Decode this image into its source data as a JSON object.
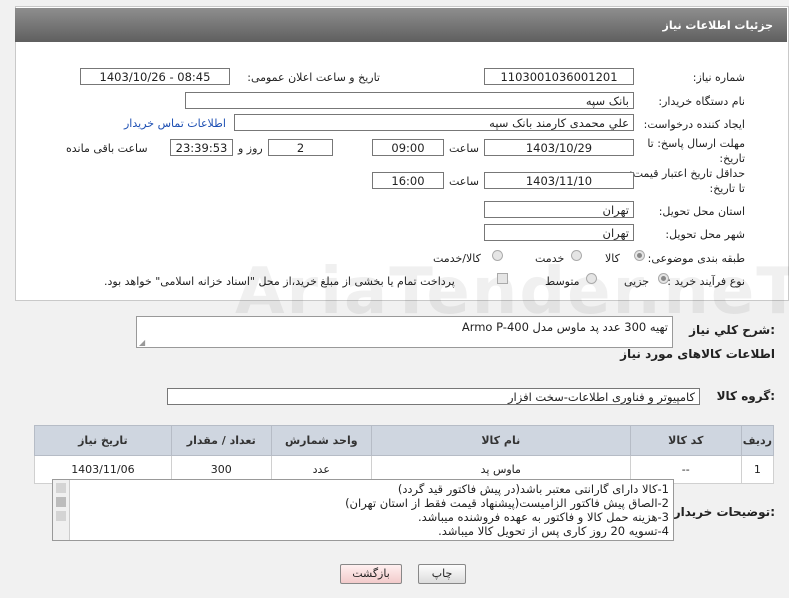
{
  "header": {
    "title": "جزئیات اطلاعات نیاز"
  },
  "form": {
    "need_number": {
      "label": "شماره نیاز:",
      "value": "1103001036001201"
    },
    "announce_datetime": {
      "label": "تاریخ و ساعت اعلان عمومی:",
      "value": "1403/10/26 - 08:45"
    },
    "buyer_org": {
      "label": "نام دستگاه خریدار:",
      "value": "بانک سپه"
    },
    "requester": {
      "label": "ایجاد کننده درخواست:",
      "value": "علي محمدی کارمند بانک سپه",
      "contact_link": "اطلاعات تماس خریدار"
    },
    "reply_deadline": {
      "label": "مهلت ارسال پاسخ: تا تاریخ:",
      "date": "1403/10/29",
      "time_label": "ساعت",
      "time": "09:00",
      "days": "2",
      "days_label": "روز و",
      "remaining": "23:39:53",
      "remaining_label": "ساعت باقی مانده"
    },
    "price_validity": {
      "label": "حداقل تاریخ اعتبار قیمت: تا تاریخ:",
      "date": "1403/11/10",
      "time_label": "ساعت",
      "time": "16:00"
    },
    "province": {
      "label": "استان محل تحویل:",
      "value": "تهران"
    },
    "city": {
      "label": "شهر محل تحویل:",
      "value": "تهران"
    },
    "category": {
      "label": "طبقه بندی موضوعی:",
      "options": [
        "کالا",
        "خدمت",
        "کالا/خدمت"
      ],
      "selected": "کالا"
    },
    "purchase_type": {
      "label": "نوع فرآیند خرید :",
      "options": [
        "جزیی",
        "متوسط"
      ],
      "selected": "جزیی",
      "payment_note": "پرداخت تمام یا بخشی از مبلغ خرید،از محل \"اسناد خزانه اسلامی\" خواهد بود."
    }
  },
  "description": {
    "label": "شرح کلي نياز:",
    "value": "تهیه 300 عدد پد ماوس مدل Armo P-400"
  },
  "goods_info": {
    "title": "اطلاعات کالاهای مورد نیاز",
    "group_label": "گروه کالا:",
    "group_value": "کامپیوتر و فناوری اطلاعات-سخت افزار",
    "columns": [
      "ردیف",
      "کد کالا",
      "نام کالا",
      "واحد شمارش",
      "تعداد / مقدار",
      "تاریخ نیاز"
    ],
    "rows": [
      [
        "1",
        "--",
        "ماوس پد",
        "عدد",
        "300",
        "1403/11/06"
      ]
    ]
  },
  "buyer_notes": {
    "label": "توضیحات خریدار:",
    "lines": [
      "1-کالا دارای گارانتی معتبر باشد(در پیش فاکتور قید گردد)",
      "2-الصاق پیش فاکتور الزامیست(پیشنهاد قیمت فقط از استان تهران)",
      "3-هزینه حمل کالا و فاکتور به عهده فروشنده میباشد.",
      "4-تسویه 20 روز کاری پس از تحویل کالا میباشد."
    ]
  },
  "buttons": {
    "print": "چاپ",
    "back": "بازگشت"
  },
  "watermark": "AriaTender.neT"
}
